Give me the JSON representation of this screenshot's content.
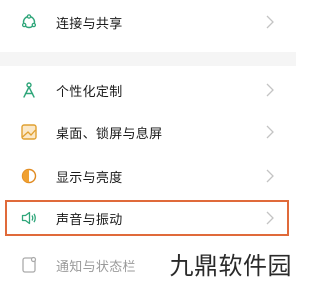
{
  "settings": {
    "items": [
      {
        "label": "连接与共享",
        "icon": "connection-share-icon",
        "color": "#2fa67a"
      },
      {
        "label": "个性化定制",
        "icon": "personalize-icon",
        "color": "#2fa67a"
      },
      {
        "label": "桌面、锁屏与息屏",
        "icon": "wallpaper-icon",
        "color": "#e0a030"
      },
      {
        "label": "显示与亮度",
        "icon": "display-brightness-icon",
        "color": "#e08a20"
      },
      {
        "label": "声音与振动",
        "icon": "sound-vibration-icon",
        "color": "#2fa67a"
      },
      {
        "label": "通知与状态栏",
        "icon": "notification-icon",
        "color": "#aaaaaa"
      }
    ]
  },
  "highlight_color": "#e06a3a",
  "watermark": "九鼎软件园"
}
